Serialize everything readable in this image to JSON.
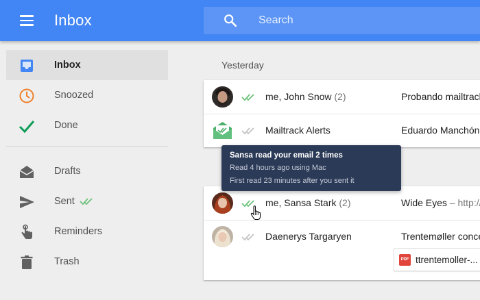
{
  "header": {
    "title": "Inbox",
    "search_placeholder": "Search"
  },
  "sidebar": {
    "items": [
      {
        "label": "Inbox",
        "icon": "inbox-icon",
        "active": true
      },
      {
        "label": "Snoozed",
        "icon": "clock-icon"
      },
      {
        "label": "Done",
        "icon": "checkmark-icon"
      },
      {
        "label": "Drafts",
        "icon": "drafts-envelope-icon"
      },
      {
        "label": "Sent",
        "icon": "send-icon"
      },
      {
        "label": "Reminders",
        "icon": "reminder-hand-icon"
      },
      {
        "label": "Trash",
        "icon": "trash-icon"
      }
    ]
  },
  "main": {
    "section_label": "Yesterday",
    "emails": [
      {
        "sender": "me, John Snow",
        "count": "(2)",
        "subject": "Probando mailtrack",
        "snippet": ""
      },
      {
        "sender": "Mailtrack Alerts",
        "count": "",
        "subject": "Eduardo Manchón",
        "snippet": ""
      },
      {
        "sender": "me, Sansa Stark",
        "count": "(2)",
        "subject": "Wide Eyes",
        "snippet": " – http://"
      },
      {
        "sender": "Daenerys Targaryen",
        "count": "",
        "subject": "Trentemøller concert",
        "snippet": ""
      }
    ],
    "attachment": {
      "type": "PDF",
      "name": "ttrentemoller-..."
    }
  },
  "tooltip": {
    "title": "Sansa read your email 2 times",
    "line1": "Read 4 hours ago using Mac",
    "line2": "First read 23 minutes after you sent it"
  },
  "colors": {
    "header": "#4285f4",
    "tick_read": "#6cc07a",
    "tick_unread": "#c4c4c4",
    "tooltip_bg": "#2b3a57"
  }
}
